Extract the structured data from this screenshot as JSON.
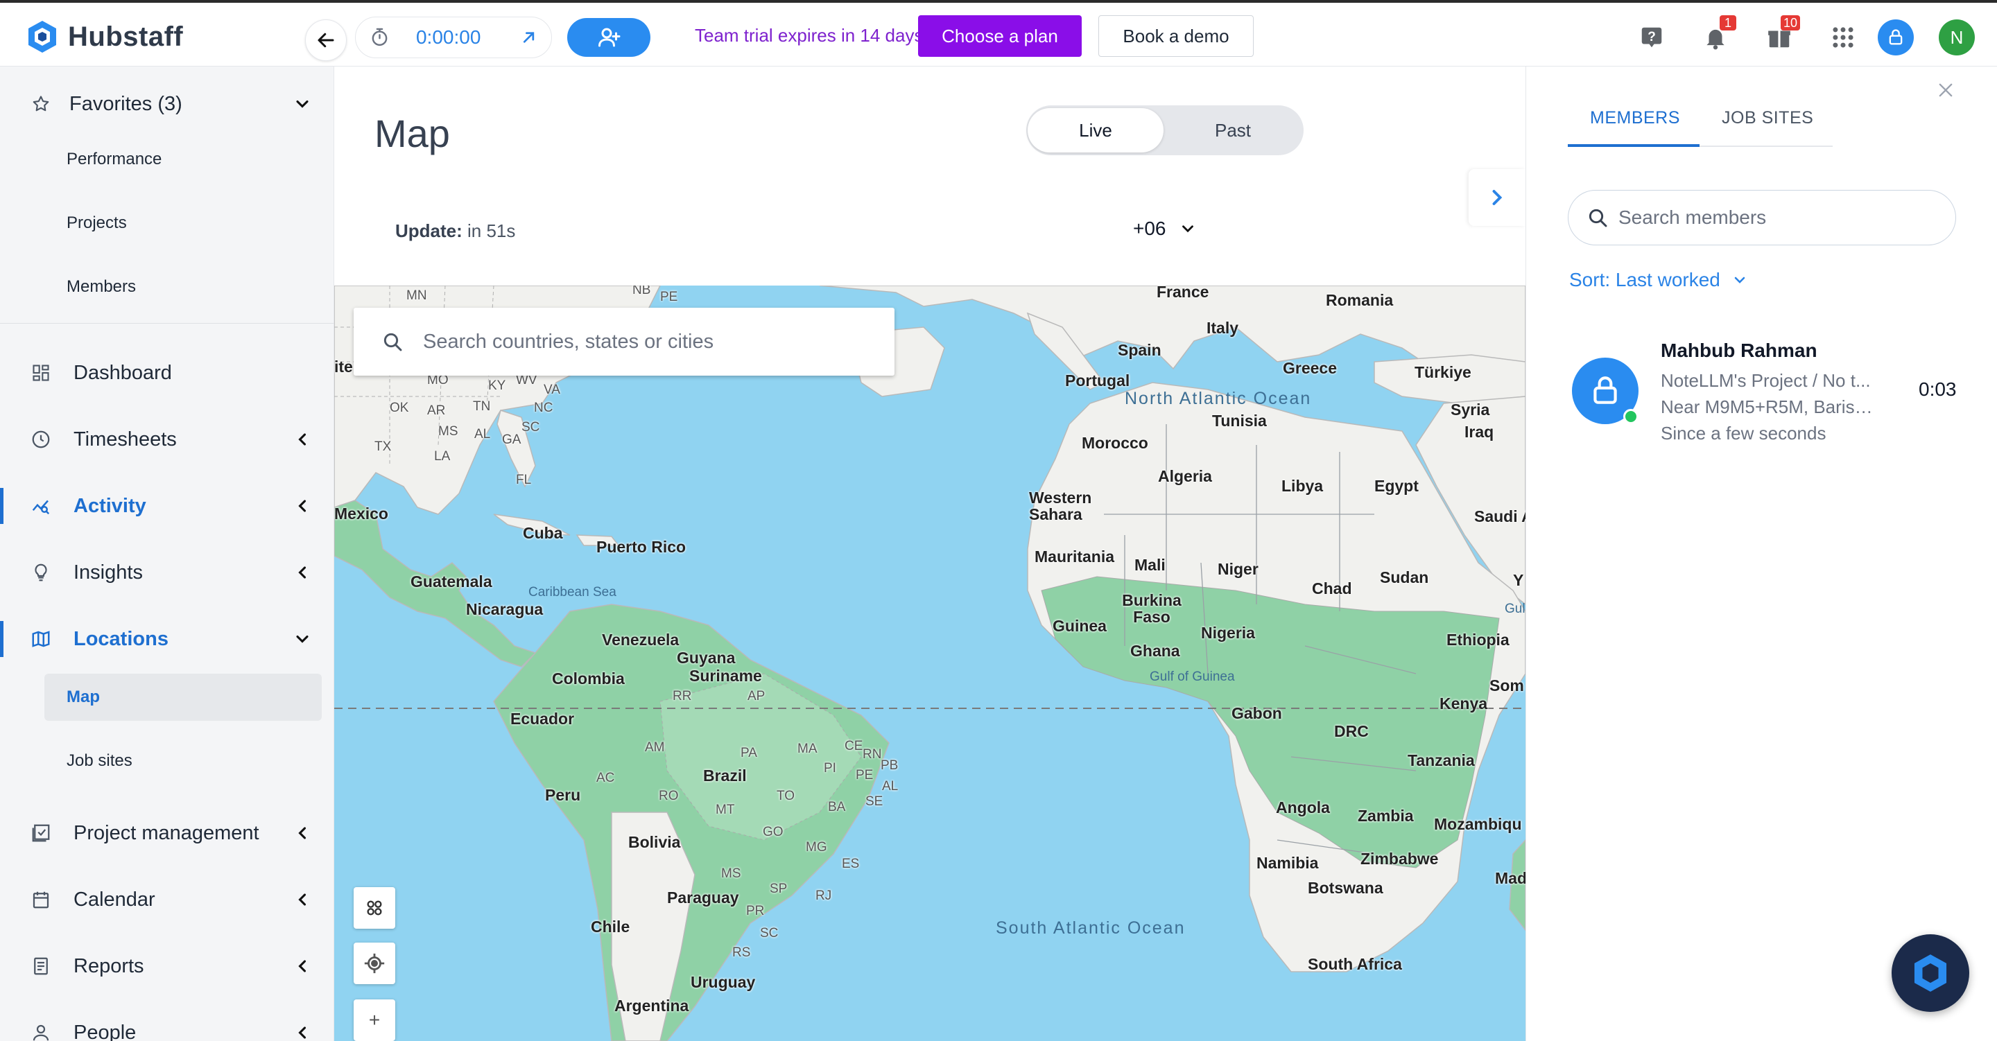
{
  "app": {
    "name": "Hubstaff"
  },
  "topbar": {
    "timer_value": "0:00:00",
    "trial_text": "Team trial expires in 14 days.",
    "choose_plan": "Choose a plan",
    "book_demo": "Book a demo",
    "notifications_count": "1",
    "gifts_count": "10",
    "user_initial": "N"
  },
  "sidebar": {
    "favorites_label": "Favorites (3)",
    "favorites": [
      "Performance",
      "Projects",
      "Members"
    ],
    "items": {
      "dashboard": "Dashboard",
      "timesheets": "Timesheets",
      "activity": "Activity",
      "insights": "Insights",
      "locations": "Locations",
      "project_management": "Project management",
      "calendar": "Calendar",
      "reports": "Reports",
      "people": "People"
    },
    "locations_sub": [
      "Map",
      "Job sites"
    ]
  },
  "main": {
    "title": "Map",
    "toggle": {
      "live": "Live",
      "past": "Past"
    },
    "update_label": "Update:",
    "update_value": "in 51s",
    "timezone": "+06"
  },
  "map": {
    "search_placeholder": "Search countries, states or cities",
    "labels": {
      "france": "France",
      "romania": "Romania",
      "italy": "Italy",
      "spain": "Spain",
      "portugal": "Portugal",
      "greece": "Greece",
      "turkiye": "Türkiye",
      "tunisia": "Tunisia",
      "syria": "Syria",
      "iraq": "Iraq",
      "morocco": "Morocco",
      "algeria": "Algeria",
      "libya": "Libya",
      "egypt": "Egypt",
      "western_sahara": "Western Sahara",
      "saudi": "Saudi A",
      "mauritania": "Mauritania",
      "mali": "Mali",
      "niger": "Niger",
      "chad": "Chad",
      "sudan": "Sudan",
      "burkina": "Burkina Faso",
      "guinea": "Guinea",
      "nigeria": "Nigeria",
      "ghana": "Ghana",
      "ethiopia": "Ethiopia",
      "gulf_guinea": "Gulf of Guinea",
      "kenya": "Kenya",
      "somalia": "Som",
      "gabon": "Gabon",
      "drc": "DRC",
      "tanzania": "Tanzania",
      "angola": "Angola",
      "zambia": "Zambia",
      "mozambique": "Mozambiqu",
      "namibia": "Namibia",
      "zimbabwe": "Zimbabwe",
      "botswana": "Botswana",
      "madagascar": "Mada",
      "south_africa": "South Africa",
      "north_atlantic": "North Atlantic Ocean",
      "south_atlantic": "South Atlantic Ocean",
      "mexico": "Mexico",
      "cuba": "Cuba",
      "puerto_rico": "Puerto Rico",
      "caribbean": "Caribbean Sea",
      "guatemala": "Guatemala",
      "nicaragua": "Nicaragua",
      "venezuela": "Venezuela",
      "guyana": "Guyana",
      "suriname": "Suriname",
      "colombia": "Colombia",
      "ecuador": "Ecuador",
      "peru": "Peru",
      "brazil": "Brazil",
      "bolivia": "Bolivia",
      "paraguay": "Paraguay",
      "chile": "Chile",
      "uruguay": "Uruguay",
      "argentina": "Argentina",
      "ite": "ite",
      "y_edge": "Y",
      "gul": "Gul"
    },
    "states": [
      "MN",
      "NB",
      "PE",
      "MO",
      "KY",
      "WV",
      "VA",
      "OK",
      "AR",
      "TN",
      "NC",
      "TX",
      "MS",
      "AL",
      "GA",
      "SC",
      "LA",
      "FL",
      "RR",
      "AP",
      "AM",
      "PA",
      "MA",
      "CE",
      "RN",
      "PB",
      "PI",
      "PE",
      "AL",
      "AC",
      "RO",
      "TO",
      "SE",
      "BA",
      "MT",
      "GO",
      "MG",
      "MS",
      "ES",
      "SP",
      "PR",
      "RJ",
      "SC",
      "RS"
    ],
    "zoom_in": "+"
  },
  "panel": {
    "tabs": {
      "members": "MEMBERS",
      "job_sites": "JOB SITES"
    },
    "search_placeholder": "Search members",
    "sort_label": "Sort: Last worked",
    "member": {
      "name": "Mahbub Rahman",
      "project": "NoteLLM's Project / No t...",
      "location": "Near M9M5+R5M, Barish...",
      "since": "Since a few seconds",
      "time": "0:03"
    }
  },
  "colors": {
    "brand_blue": "#1e6fd0",
    "plan_purple": "#8a0ee8",
    "trial_purple": "#7e22ce",
    "water": "#90d3f1",
    "land": "#f1f1ee",
    "land_green": "#8fd1a6"
  }
}
